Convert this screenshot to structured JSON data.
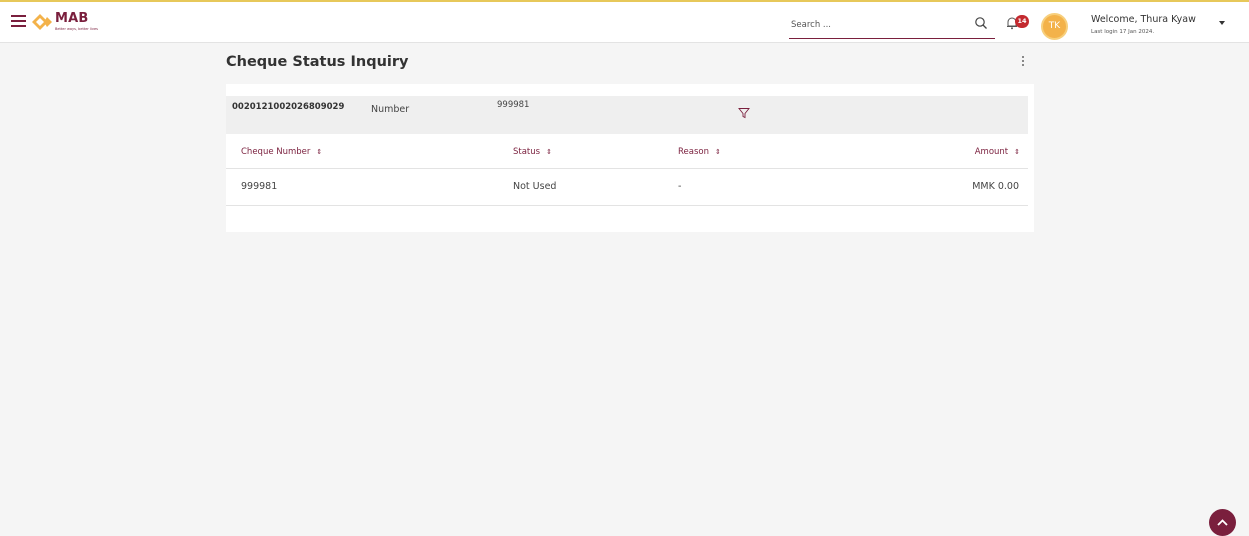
{
  "header": {
    "logo_text": "MAB",
    "logo_tagline": "Better ways, better lives",
    "search_placeholder": "Search ...",
    "notifications_count": "14",
    "avatar_initials": "TK",
    "welcome": "Welcome, Thura Kyaw",
    "last_login": "Last login 17 Jan 2024."
  },
  "page": {
    "title": "Cheque Status Inquiry"
  },
  "filter": {
    "account_number": "0020121002026809029",
    "label": "Number",
    "value": "999981"
  },
  "table": {
    "columns": [
      "Cheque Number",
      "Status",
      "Reason",
      "Amount"
    ],
    "rows": [
      {
        "cheque_number": "999981",
        "status": "Not Used",
        "reason": "-",
        "amount": "MMK 0.00"
      }
    ]
  },
  "colors": {
    "brand": "#7a1f3d",
    "accent": "#f3b24a",
    "badge": "#c32a2f"
  }
}
